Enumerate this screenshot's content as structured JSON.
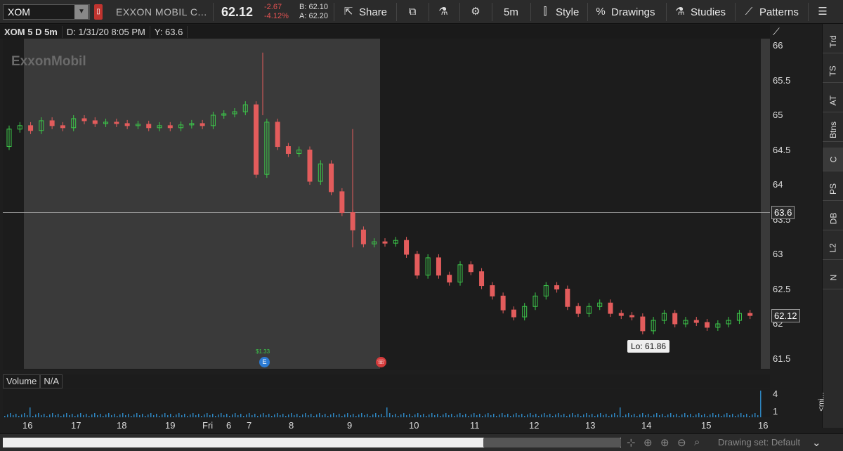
{
  "toolbar": {
    "symbol": "XOM",
    "company": "EXXON MOBIL C...",
    "last": "62.12",
    "net_change": "-2.67",
    "pct_change": "-4.12%",
    "bid": "B: 62.10",
    "ask": "A: 62.20",
    "share_label": "Share",
    "timeframe": "5m",
    "style_label": "Style",
    "drawings_label": "Drawings",
    "studies_label": "Studies",
    "patterns_label": "Patterns"
  },
  "infobar": {
    "title": "XOM 5 D 5m",
    "date": "D: 1/31/20 8:05 PM",
    "cursor_y": "Y: 63.6"
  },
  "chart": {
    "watermark": "ExxonMobil",
    "yticks": [
      "66",
      "65.5",
      "65",
      "64.5",
      "64",
      "63.5",
      "63",
      "62.5",
      "62",
      "61.5"
    ],
    "crosshair_label": "63.6",
    "last_price_label": "62.12",
    "low_label": "Lo: 61.86",
    "dividend_label": "$1.33",
    "xticks": [
      "16",
      "17",
      "18",
      "19",
      "Fri",
      "6",
      "7",
      "8",
      "9",
      "10",
      "11",
      "12",
      "13",
      "14",
      "15",
      "16"
    ]
  },
  "volume": {
    "title": "Volume",
    "value": "N/A",
    "yticks": [
      "4",
      "1"
    ],
    "side_label": "<mi..."
  },
  "right_tabs": [
    "Trd",
    "TS",
    "AT",
    "Btns",
    "C",
    "PS",
    "DB",
    "L2",
    "N"
  ],
  "bottom": {
    "drawing_set": "Drawing set: Default"
  },
  "colors": {
    "up": "#3cc84a",
    "down": "#e35c5c",
    "premarket_shade": "#3a3a3a"
  }
}
